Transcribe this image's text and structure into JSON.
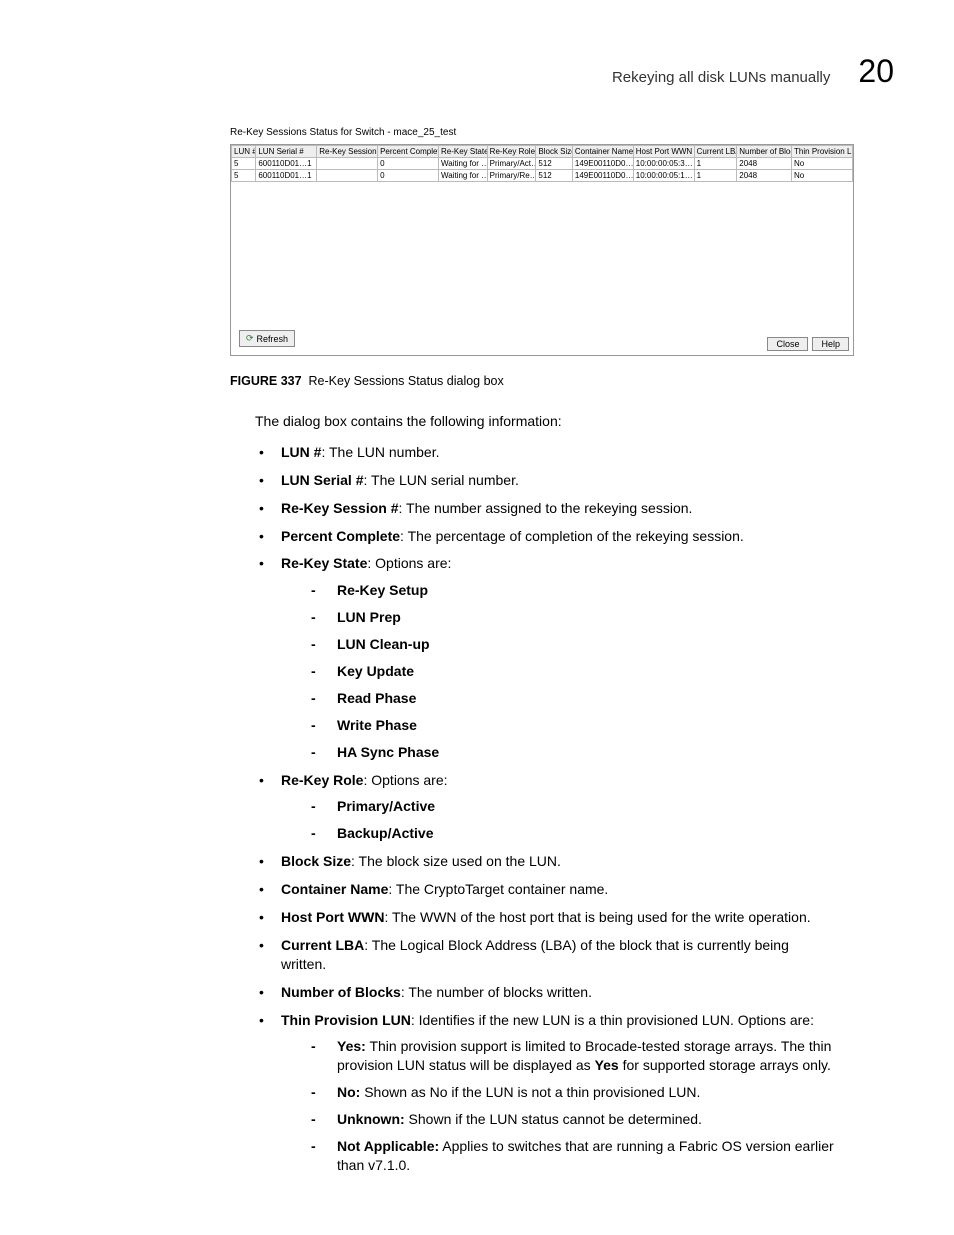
{
  "header": {
    "title": "Rekeying all disk LUNs manually",
    "chapter": "20"
  },
  "screenshot": {
    "title_prefix": "Re-Key Sessions Status for Switch - ",
    "switch_name": "mace_25_test",
    "columns": [
      "LUN #",
      "LUN Serial #",
      "Re-Key Session #",
      "Percent Complete",
      "Re-Key State",
      "Re-Key Role",
      "Block Size",
      "Container Name",
      "Host Port WWN",
      "Current LBA",
      "Number of Blocks",
      "Thin Provision LUN"
    ],
    "rows": [
      {
        "lun": "5",
        "serial": "600110D01…1",
        "session": "",
        "percent": "0",
        "state": "Waiting for …",
        "role": "Primary/Act…",
        "block": "512",
        "container": "149E00110D0…",
        "wwn": "10:00:00:05:3…",
        "lba": "1",
        "nblocks": "2048",
        "thin": "No"
      },
      {
        "lun": "5",
        "serial": "600110D01…1",
        "session": "",
        "percent": "0",
        "state": "Waiting for …",
        "role": "Primary/Re…",
        "block": "512",
        "container": "149E00110D0…",
        "wwn": "10:00:00:05:1…",
        "lba": "1",
        "nblocks": "2048",
        "thin": "No"
      }
    ],
    "refresh": "Refresh",
    "close": "Close",
    "help": "Help"
  },
  "figure": {
    "label": "FIGURE 337",
    "caption": "Re-Key Sessions Status dialog box"
  },
  "body": {
    "intro": "The dialog box contains the following information:",
    "items": [
      {
        "term": "LUN #",
        "desc": ": The LUN number."
      },
      {
        "term": "LUN Serial #",
        "desc": ": The LUN serial number."
      },
      {
        "term": "Re-Key Session #",
        "desc": ": The number assigned to the rekeying session."
      },
      {
        "term": "Percent Complete",
        "desc": ": The percentage of completion of the rekeying session."
      },
      {
        "term": "Re-Key State",
        "desc": ": Options are:",
        "sub": [
          {
            "text": "Re-Key Setup",
            "bold": true
          },
          {
            "text": "LUN Prep",
            "bold": true
          },
          {
            "text": "LUN Clean-up",
            "bold": true
          },
          {
            "text": "Key Update",
            "bold": true
          },
          {
            "text": "Read Phase",
            "bold": true
          },
          {
            "text": "Write Phase",
            "bold": true
          },
          {
            "text": "HA Sync Phase",
            "bold": true
          }
        ]
      },
      {
        "term": "Re-Key Role",
        "desc": ": Options are:",
        "sub": [
          {
            "text": "Primary/Active",
            "bold": true
          },
          {
            "text": "Backup/Active",
            "bold": true
          }
        ]
      },
      {
        "term": "Block Size",
        "desc": ": The block size used on the LUN."
      },
      {
        "term": "Container Name",
        "desc": ": The CryptoTarget container name."
      },
      {
        "term": "Host Port WWN",
        "desc": ": The WWN of the host port that is being used for the write operation."
      },
      {
        "term": "Current LBA",
        "desc": ": The Logical Block Address (LBA) of the block that is currently being written."
      },
      {
        "term": "Number of Blocks",
        "desc": ": The number of blocks written."
      },
      {
        "term": "Thin Provision LUN",
        "desc": ": Identifies if the new LUN is a thin provisioned LUN. Options are:",
        "sub": [
          {
            "prefix": "Yes:",
            "text": " Thin provision support is limited to Brocade-tested storage arrays. The thin provision LUN status will be displayed as ",
            "mid": "Yes",
            "suffix": " for supported storage arrays only."
          },
          {
            "prefix": "No:",
            "text": " Shown as No if the LUN is not a thin provisioned LUN."
          },
          {
            "prefix": "Unknown:",
            "text": " Shown if the LUN status cannot be determined."
          },
          {
            "prefix": "Not Applicable:",
            "text": " Applies to switches that are running a Fabric OS version earlier than v7.1.0."
          }
        ]
      }
    ]
  }
}
